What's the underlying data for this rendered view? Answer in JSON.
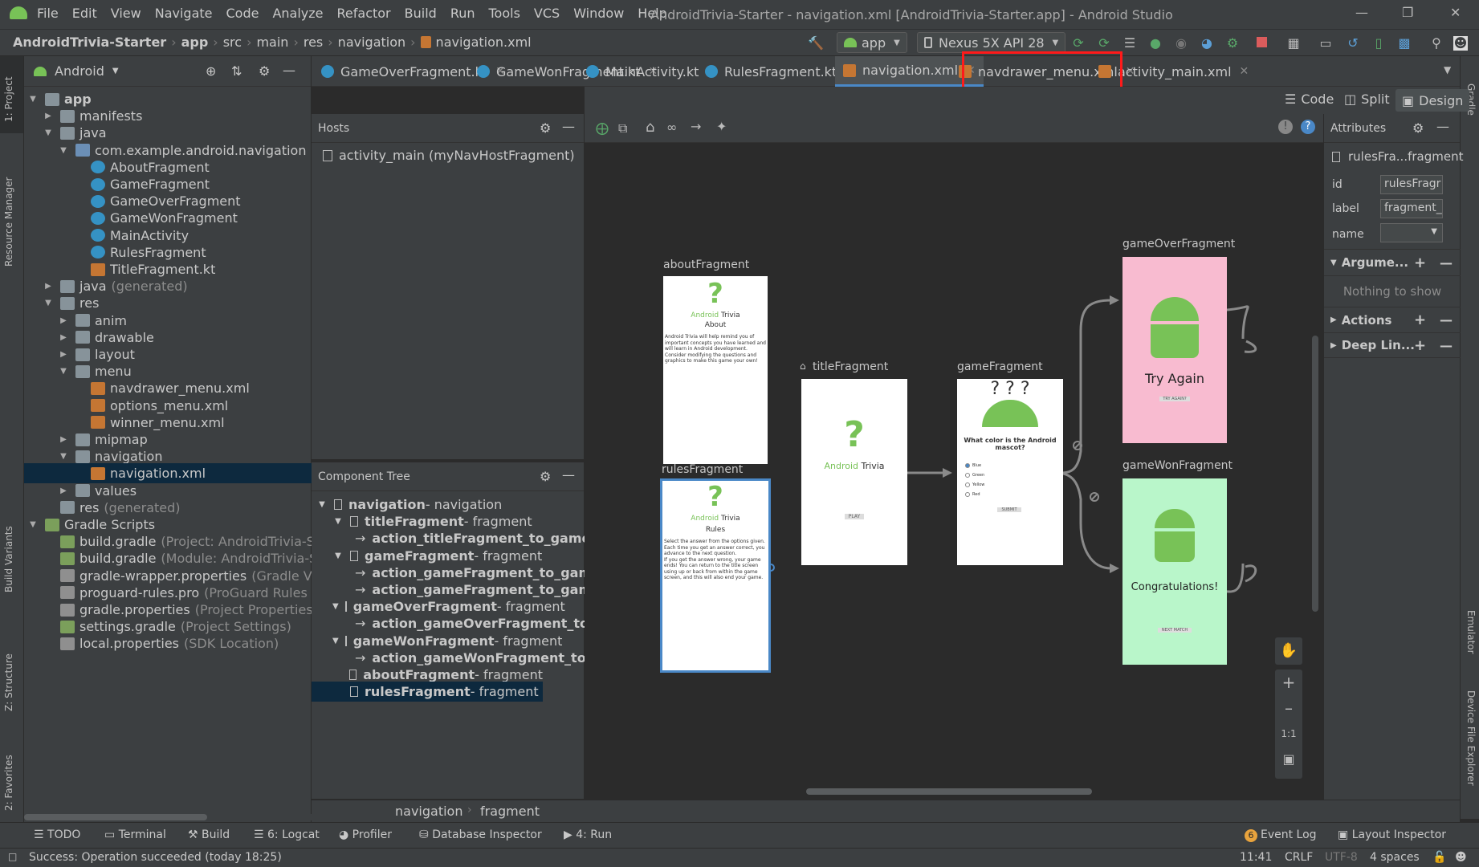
{
  "window": {
    "title": "AndroidTrivia-Starter - navigation.xml [AndroidTrivia-Starter.app] - Android Studio",
    "menu": [
      "File",
      "Edit",
      "View",
      "Navigate",
      "Code",
      "Analyze",
      "Refactor",
      "Build",
      "Run",
      "Tools",
      "VCS",
      "Window",
      "Help"
    ]
  },
  "breadcrumb": [
    "AndroidTrivia-Starter",
    "app",
    "src",
    "main",
    "res",
    "navigation",
    "navigation.xml"
  ],
  "toolbar": {
    "run_config": "app",
    "device": "Nexus 5X API 28"
  },
  "project_panel": {
    "title": "Android",
    "tree": [
      {
        "label": "app",
        "depth": 0,
        "expanded": true,
        "icon": "folder-icon",
        "bold": true
      },
      {
        "label": "manifests",
        "depth": 1,
        "expanded": false,
        "icon": "folder-icon"
      },
      {
        "label": "java",
        "depth": 1,
        "expanded": true,
        "icon": "folder-icon"
      },
      {
        "label": "com.example.android.navigation",
        "depth": 2,
        "expanded": true,
        "icon": "package-icon"
      },
      {
        "label": "AboutFragment",
        "depth": 3,
        "icon": "kotlin-class-icon"
      },
      {
        "label": "GameFragment",
        "depth": 3,
        "icon": "kotlin-class-icon"
      },
      {
        "label": "GameOverFragment",
        "depth": 3,
        "icon": "kotlin-class-icon"
      },
      {
        "label": "GameWonFragment",
        "depth": 3,
        "icon": "kotlin-class-icon"
      },
      {
        "label": "MainActivity",
        "depth": 3,
        "icon": "kotlin-class-icon"
      },
      {
        "label": "RulesFragment",
        "depth": 3,
        "icon": "kotlin-class-icon"
      },
      {
        "label": "TitleFragment.kt",
        "depth": 3,
        "icon": "kotlin-file-icon"
      },
      {
        "label": "java",
        "suffix": "(generated)",
        "depth": 1,
        "expanded": false,
        "icon": "folder-icon"
      },
      {
        "label": "res",
        "depth": 1,
        "expanded": true,
        "icon": "folder-icon"
      },
      {
        "label": "anim",
        "depth": 2,
        "expanded": false,
        "icon": "folder-icon"
      },
      {
        "label": "drawable",
        "depth": 2,
        "expanded": false,
        "icon": "folder-icon"
      },
      {
        "label": "layout",
        "depth": 2,
        "expanded": false,
        "icon": "folder-icon"
      },
      {
        "label": "menu",
        "depth": 2,
        "expanded": true,
        "icon": "folder-icon"
      },
      {
        "label": "navdrawer_menu.xml",
        "depth": 3,
        "icon": "xml-icon"
      },
      {
        "label": "options_menu.xml",
        "depth": 3,
        "icon": "xml-icon"
      },
      {
        "label": "winner_menu.xml",
        "depth": 3,
        "icon": "xml-icon"
      },
      {
        "label": "mipmap",
        "depth": 2,
        "expanded": false,
        "icon": "folder-icon"
      },
      {
        "label": "navigation",
        "depth": 2,
        "expanded": true,
        "icon": "folder-icon"
      },
      {
        "label": "navigation.xml",
        "depth": 3,
        "icon": "xml-icon",
        "selected": true
      },
      {
        "label": "values",
        "depth": 2,
        "expanded": false,
        "icon": "folder-icon"
      },
      {
        "label": "res",
        "suffix": "(generated)",
        "depth": 1,
        "icon": "folder-icon"
      },
      {
        "label": "Gradle Scripts",
        "depth": 0,
        "expanded": true,
        "icon": "gradle-icon"
      },
      {
        "label": "build.gradle",
        "suffix": "(Project: AndroidTrivia-Sta",
        "depth": 1,
        "icon": "gradle-icon"
      },
      {
        "label": "build.gradle",
        "suffix": "(Module: AndroidTrivia-Sta",
        "depth": 1,
        "icon": "gradle-icon"
      },
      {
        "label": "gradle-wrapper.properties",
        "suffix": "(Gradle Vers",
        "depth": 1,
        "icon": "properties-icon"
      },
      {
        "label": "proguard-rules.pro",
        "suffix": "(ProGuard Rules for",
        "depth": 1,
        "icon": "properties-icon"
      },
      {
        "label": "gradle.properties",
        "suffix": "(Project Properties)",
        "depth": 1,
        "icon": "properties-icon"
      },
      {
        "label": "settings.gradle",
        "suffix": "(Project Settings)",
        "depth": 1,
        "icon": "gradle-icon"
      },
      {
        "label": "local.properties",
        "suffix": "(SDK Location)",
        "depth": 1,
        "icon": "properties-icon"
      }
    ]
  },
  "editor_tabs": [
    {
      "label": "GameOverFragment.kt"
    },
    {
      "label": "GameWonFragment.kt"
    },
    {
      "label": "MainActivity.kt"
    },
    {
      "label": "RulesFragment.kt"
    },
    {
      "label": "navigation.xml",
      "active": true
    },
    {
      "label": "navdrawer_menu.xml"
    },
    {
      "label": "activity_main.xml"
    }
  ],
  "view_modes": {
    "code": "Code",
    "split": "Split",
    "design": "Design"
  },
  "hosts": {
    "title": "Hosts",
    "item": "activity_main (myNavHostFragment)"
  },
  "component_tree": {
    "title": "Component Tree",
    "items": [
      {
        "name": "navigation",
        "type": " - navigation",
        "depth": 0,
        "expanded": true
      },
      {
        "name": "titleFragment",
        "type": " - fragment",
        "depth": 1,
        "expanded": true
      },
      {
        "name": "action_titleFragment_to_game...",
        "depth": 2,
        "action": true
      },
      {
        "name": "gameFragment",
        "type": " - fragment",
        "depth": 1,
        "expanded": true
      },
      {
        "name": "action_gameFragment_to_gam...",
        "depth": 2,
        "action": true
      },
      {
        "name": "action_gameFragment_to_gam...",
        "depth": 2,
        "action": true
      },
      {
        "name": "gameOverFragment",
        "type": " - fragment",
        "depth": 1,
        "expanded": true
      },
      {
        "name": "action_gameOverFragment_to...",
        "depth": 2,
        "action": true
      },
      {
        "name": "gameWonFragment",
        "type": " - fragment",
        "depth": 1,
        "expanded": true
      },
      {
        "name": "action_gameWonFragment_to...",
        "depth": 2,
        "action": true
      },
      {
        "name": "aboutFragment",
        "type": " - fragment",
        "depth": 1
      },
      {
        "name": "rulesFragment",
        "type": " - fragment",
        "depth": 1,
        "selected": true
      }
    ]
  },
  "graph": {
    "about": {
      "label": "aboutFragment",
      "brand": "Android",
      "brand2": "Trivia",
      "heading": "About",
      "body": "Android Trivia will help remind you of important concepts you have learned and will learn in Android development.\nConsider modifying the questions and graphics to make this game your own!"
    },
    "rules": {
      "label": "rulesFragment",
      "brand": "Android",
      "brand2": "Trivia",
      "heading": "Rules",
      "body": "Select the answer from the options given. Each time you get an answer correct, you advance to the next question.\nIf you get the answer wrong, your game ends! You can return to the title screen using up or back from within the game screen, and this will also end your game."
    },
    "title": {
      "label": "titleFragment",
      "brand": "Android",
      "brand2": "Trivia",
      "button": "PLAY"
    },
    "game": {
      "label": "gameFragment",
      "question": "What color is the Android mascot?",
      "options": [
        "Blue",
        "Green",
        "Yellow",
        "Red"
      ],
      "button": "SUBMIT"
    },
    "gameover": {
      "label": "gameOverFragment",
      "text": "Try Again",
      "button": "TRY AGAIN?"
    },
    "gamewon": {
      "label": "gameWonFragment",
      "text": "Congratulations!",
      "button": "NEXT MATCH"
    }
  },
  "zoom_controls": {
    "fit": "1:1"
  },
  "attributes": {
    "title": "Attributes",
    "selected": "rulesFra...fragment",
    "id_label": "id",
    "id_value": "rulesFragr",
    "label_label": "label",
    "label_value": "fragment_",
    "name_label": "name",
    "sections": [
      "Argume...",
      "Actions",
      "Deep Lin..."
    ],
    "empty": "Nothing to show"
  },
  "bottom_crumbs": [
    "navigation",
    "fragment"
  ],
  "bottom_tools": [
    {
      "label": "TODO"
    },
    {
      "label": "Terminal"
    },
    {
      "label": "Build"
    },
    {
      "label": "6: Logcat"
    },
    {
      "label": "Profiler"
    },
    {
      "label": "Database Inspector"
    },
    {
      "label": "4: Run"
    },
    {
      "label": "Event Log"
    },
    {
      "label": "Layout Inspector"
    }
  ],
  "event_badge": "6",
  "status": {
    "message": "Success: Operation succeeded (today 18:25)",
    "position": "11:41",
    "line_sep": "CRLF",
    "encoding": "UTF-8",
    "indent": "4 spaces"
  },
  "side_tabs": {
    "project": "1: Project",
    "resource_manager": "Resource Manager",
    "build_variants": "Build Variants",
    "structure": "Z: Structure",
    "favorites": "2: Favorites",
    "gradle": "Gradle",
    "emulator": "Emulator",
    "device_explorer": "Device File Explorer"
  },
  "colors": {
    "android_green": "#78c257",
    "gameover_bg": "#f8bbd0",
    "gamewon_bg": "#b9f6ca",
    "accent": "#4a88c7",
    "highlight": "#ff1a1a"
  }
}
